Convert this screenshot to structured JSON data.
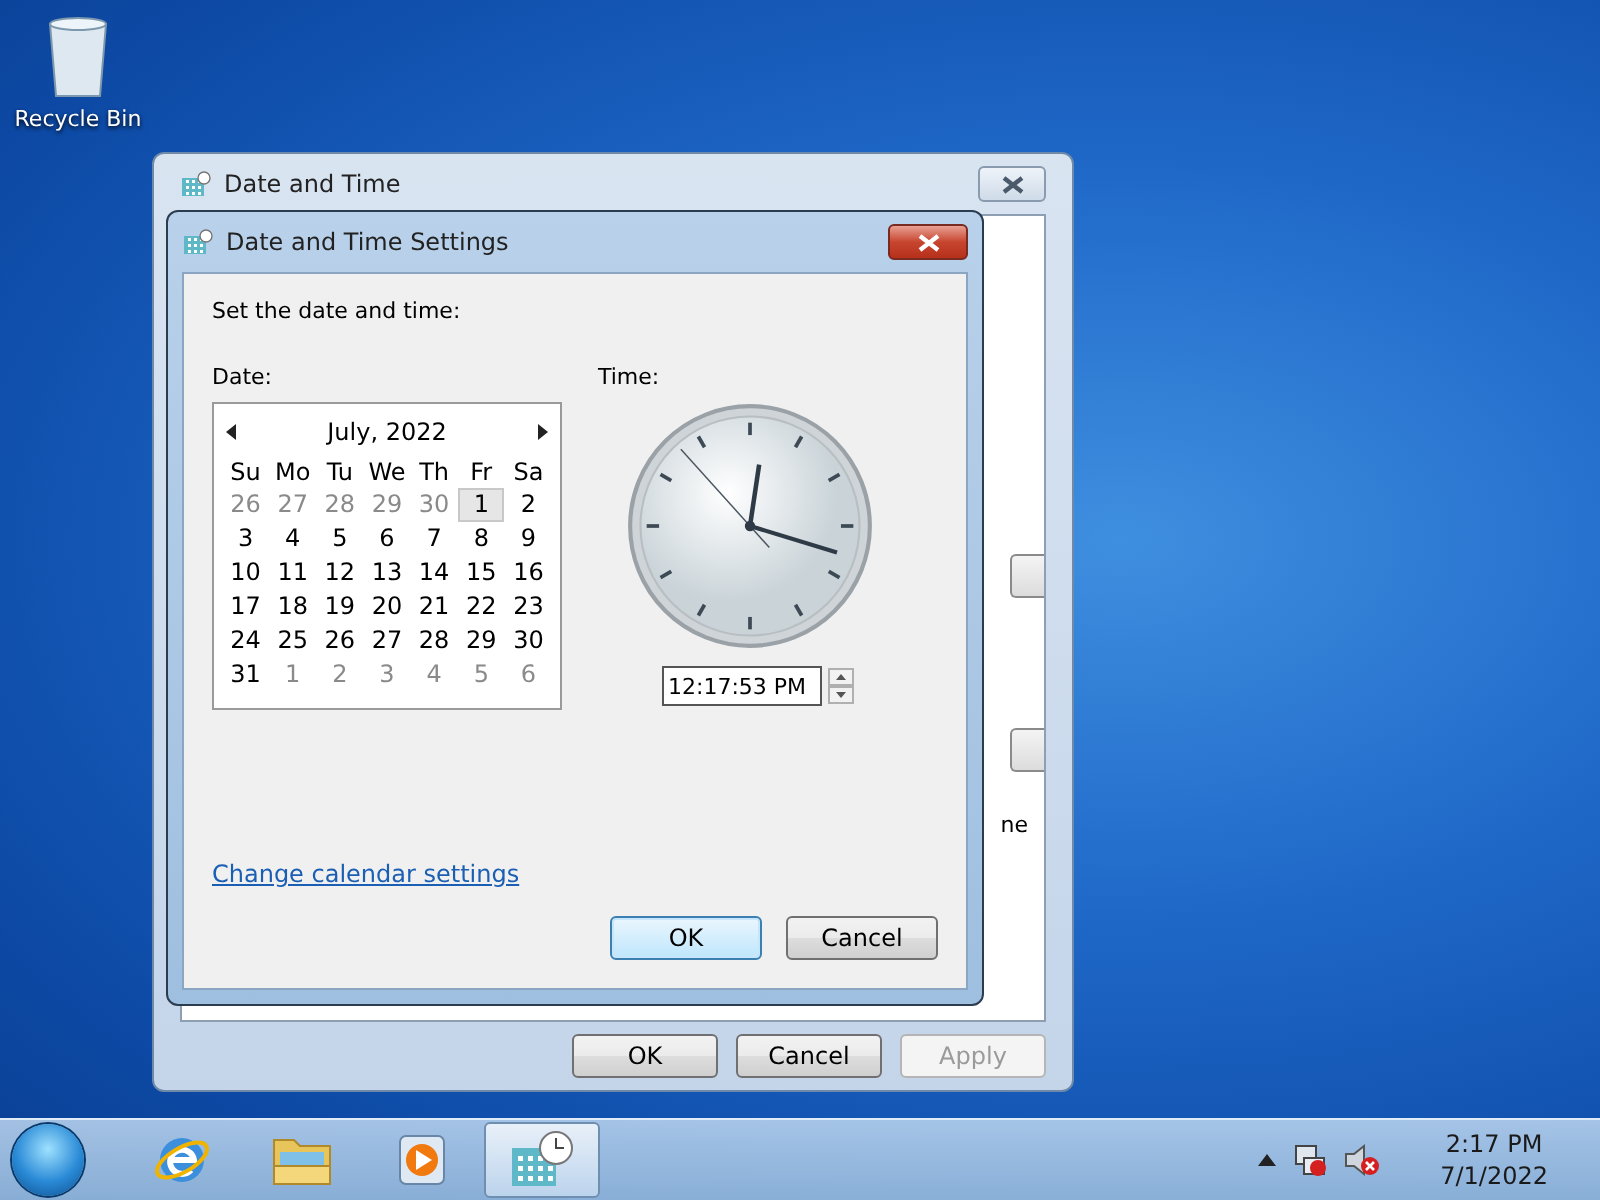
{
  "desktop_icons": [
    {
      "label": "Recycle Bin"
    }
  ],
  "parent_window": {
    "title": "Date and Time",
    "fragment": "ne",
    "buttons": [
      {
        "label": "OK",
        "disabled": false
      },
      {
        "label": "Cancel",
        "disabled": false
      },
      {
        "label": "Apply",
        "disabled": true
      }
    ]
  },
  "dialog": {
    "title": "Date and Time Settings",
    "instruction": "Set the date and time:",
    "date_label": "Date:",
    "time_label": "Time:",
    "calendar": {
      "month": "July, 2022",
      "weekdays": [
        "Su",
        "Mo",
        "Tu",
        "We",
        "Th",
        "Fr",
        "Sa"
      ],
      "days": [
        {
          "label": "26",
          "current_month": false,
          "selected": false
        },
        {
          "label": "27",
          "current_month": false,
          "selected": false
        },
        {
          "label": "28",
          "current_month": false,
          "selected": false
        },
        {
          "label": "29",
          "current_month": false,
          "selected": false
        },
        {
          "label": "30",
          "current_month": false,
          "selected": false
        },
        {
          "label": "1",
          "current_month": true,
          "selected": true
        },
        {
          "label": "2",
          "current_month": true,
          "selected": false
        },
        {
          "label": "3",
          "current_month": true,
          "selected": false
        },
        {
          "label": "4",
          "current_month": true,
          "selected": false
        },
        {
          "label": "5",
          "current_month": true,
          "selected": false
        },
        {
          "label": "6",
          "current_month": true,
          "selected": false
        },
        {
          "label": "7",
          "current_month": true,
          "selected": false
        },
        {
          "label": "8",
          "current_month": true,
          "selected": false
        },
        {
          "label": "9",
          "current_month": true,
          "selected": false
        },
        {
          "label": "10",
          "current_month": true,
          "selected": false
        },
        {
          "label": "11",
          "current_month": true,
          "selected": false
        },
        {
          "label": "12",
          "current_month": true,
          "selected": false
        },
        {
          "label": "13",
          "current_month": true,
          "selected": false
        },
        {
          "label": "14",
          "current_month": true,
          "selected": false
        },
        {
          "label": "15",
          "current_month": true,
          "selected": false
        },
        {
          "label": "16",
          "current_month": true,
          "selected": false
        },
        {
          "label": "17",
          "current_month": true,
          "selected": false
        },
        {
          "label": "18",
          "current_month": true,
          "selected": false
        },
        {
          "label": "19",
          "current_month": true,
          "selected": false
        },
        {
          "label": "20",
          "current_month": true,
          "selected": false
        },
        {
          "label": "21",
          "current_month": true,
          "selected": false
        },
        {
          "label": "22",
          "current_month": true,
          "selected": false
        },
        {
          "label": "23",
          "current_month": true,
          "selected": false
        },
        {
          "label": "24",
          "current_month": true,
          "selected": false
        },
        {
          "label": "25",
          "current_month": true,
          "selected": false
        },
        {
          "label": "26",
          "current_month": true,
          "selected": false
        },
        {
          "label": "27",
          "current_month": true,
          "selected": false
        },
        {
          "label": "28",
          "current_month": true,
          "selected": false
        },
        {
          "label": "29",
          "current_month": true,
          "selected": false
        },
        {
          "label": "30",
          "current_month": true,
          "selected": false
        },
        {
          "label": "31",
          "current_month": true,
          "selected": false
        },
        {
          "label": "1",
          "current_month": false,
          "selected": false
        },
        {
          "label": "2",
          "current_month": false,
          "selected": false
        },
        {
          "label": "3",
          "current_month": false,
          "selected": false
        },
        {
          "label": "4",
          "current_month": false,
          "selected": false
        },
        {
          "label": "5",
          "current_month": false,
          "selected": false
        },
        {
          "label": "6",
          "current_month": false,
          "selected": false
        }
      ]
    },
    "time_value": "12:17:53 PM",
    "link": "Change calendar settings",
    "buttons": [
      {
        "label": "OK",
        "default": true
      },
      {
        "label": "Cancel",
        "default": false
      }
    ]
  },
  "taskbar": {
    "apps": [
      {
        "kind": "browser",
        "active": false
      },
      {
        "kind": "folder",
        "active": false
      },
      {
        "kind": "media",
        "active": false
      },
      {
        "kind": "calendar",
        "active": true
      }
    ],
    "clock": {
      "time": "2:17 PM",
      "date": "7/1/2022"
    }
  }
}
